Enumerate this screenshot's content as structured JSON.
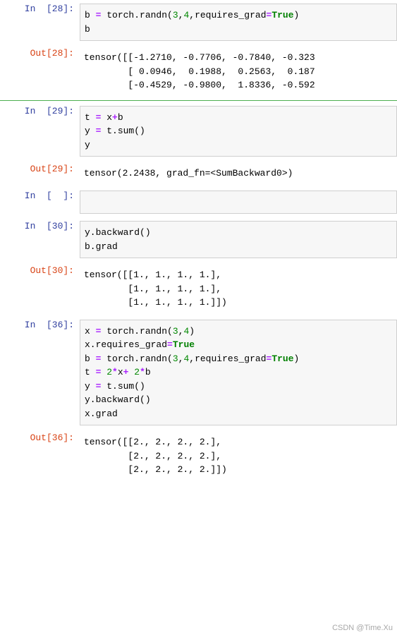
{
  "cells": [
    {
      "kind": "in",
      "prompt": "In  [28]:",
      "code_html": "b <span class=\"tok-op\">=</span> torch.randn(<span class=\"tok-num\">3</span>,<span class=\"tok-num\">4</span>,requires_grad<span class=\"tok-op\">=</span><span class=\"tok-kw\">True</span>)\nb"
    },
    {
      "kind": "out",
      "prompt": "Out[28]:",
      "text": "tensor([[-1.2710, -0.7706, -0.7840, -0.323\n        [ 0.0946,  0.1988,  0.2563,  0.187\n        [-0.4529, -0.9800,  1.8336, -0.592"
    },
    {
      "kind": "divider"
    },
    {
      "kind": "in",
      "prompt": "In  [29]:",
      "code_html": "t <span class=\"tok-op\">=</span> x<span class=\"tok-op\">+</span>b\ny <span class=\"tok-op\">=</span> t.sum()\ny"
    },
    {
      "kind": "out",
      "prompt": "Out[29]:",
      "text": "tensor(2.2438, grad_fn=<SumBackward0>)"
    },
    {
      "kind": "in",
      "prompt": "In  [  ]:",
      "code_html": ""
    },
    {
      "kind": "in",
      "prompt": "In  [30]:",
      "code_html": "y.backward()\nb.grad"
    },
    {
      "kind": "out",
      "prompt": "Out[30]:",
      "text": "tensor([[1., 1., 1., 1.],\n        [1., 1., 1., 1.],\n        [1., 1., 1., 1.]])"
    },
    {
      "kind": "in",
      "prompt": "In  [36]:",
      "code_html": "x <span class=\"tok-op\">=</span> torch.randn(<span class=\"tok-num\">3</span>,<span class=\"tok-num\">4</span>)\nx.requires_grad<span class=\"tok-op\">=</span><span class=\"tok-kw\">True</span>\nb <span class=\"tok-op\">=</span> torch.randn(<span class=\"tok-num\">3</span>,<span class=\"tok-num\">4</span>,requires_grad<span class=\"tok-op\">=</span><span class=\"tok-kw\">True</span>)\nt <span class=\"tok-op\">=</span> <span class=\"tok-num\">2</span><span class=\"tok-op\">*</span>x<span class=\"tok-op\">+</span> <span class=\"tok-num\">2</span><span class=\"tok-op\">*</span>b\ny <span class=\"tok-op\">=</span> t.sum()\ny.backward()\nx.grad"
    },
    {
      "kind": "out",
      "prompt": "Out[36]:",
      "text": "tensor([[2., 2., 2., 2.],\n        [2., 2., 2., 2.],\n        [2., 2., 2., 2.]])"
    }
  ],
  "watermark": "CSDN @Time.Xu"
}
